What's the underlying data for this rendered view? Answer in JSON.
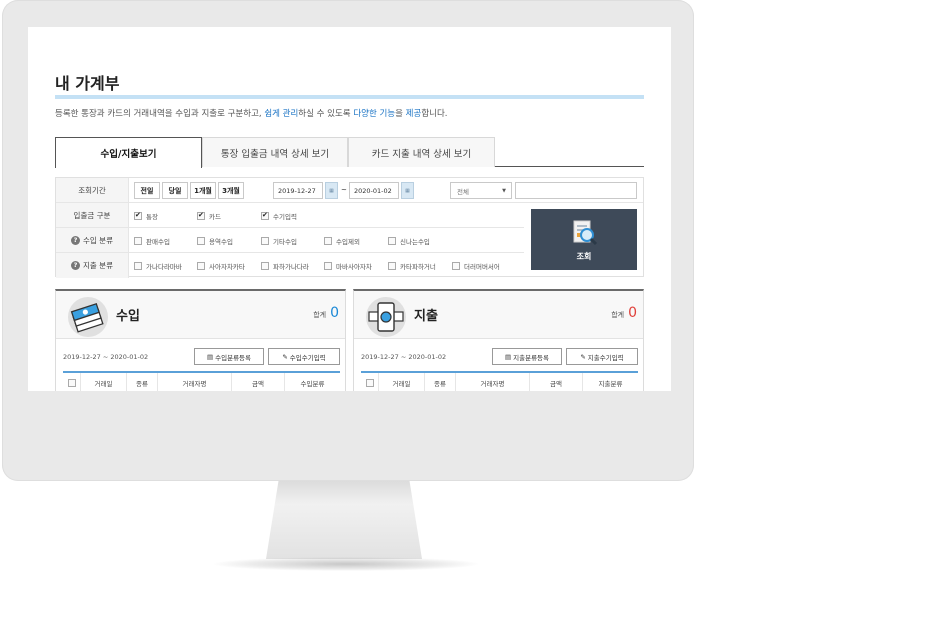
{
  "page": {
    "title": "내 가계부",
    "description": [
      {
        "text": "등록한 통장과 카드의 거래내역을 수입과 지출로 구분하고, ",
        "highlight": false
      },
      {
        "text": "쉽게 관리",
        "highlight": true
      },
      {
        "text": "하실 수 있도록 ",
        "highlight": false
      },
      {
        "text": "다양한 기능",
        "highlight": true
      },
      {
        "text": "을 ",
        "highlight": false
      },
      {
        "text": "제공",
        "highlight": true
      },
      {
        "text": "합니다.",
        "highlight": false
      }
    ]
  },
  "tabs": [
    {
      "label": "수입/지출보기",
      "active": true
    },
    {
      "label": "통장 입출금 내역 상세 보기",
      "active": false
    },
    {
      "label": "카드 지출 내역 상세 보기",
      "active": false
    }
  ],
  "filter": {
    "period_label": "조회기간",
    "period_buttons": [
      "전일",
      "당일",
      "1개월",
      "3개월"
    ],
    "date_from": "2019-12-27",
    "date_sep": "~",
    "date_to": "2020-01-02",
    "select_value": "전체",
    "type_label": "입출금 구분",
    "type_options": [
      {
        "label": "통장",
        "checked": true
      },
      {
        "label": "카드",
        "checked": true
      },
      {
        "label": "수기입력",
        "checked": true
      }
    ],
    "income_cat_label": "수입 분류",
    "income_cats": [
      "판매수입",
      "용역수입",
      "기타수입",
      "수입제외",
      "신나는수입"
    ],
    "expense_cat_label": "지출 분류",
    "expense_cats": [
      "가나다라마바",
      "사아자차카타",
      "파하가나다라",
      "마바사아자차",
      "카타파하거너",
      "더러머버서어"
    ],
    "search_label": "조회"
  },
  "income": {
    "title": "수입",
    "total_label": "합계",
    "total_value": "0",
    "total_color": "#1a88d6",
    "range": "2019-12-27 ~ 2020-01-02",
    "btn1": "수입분류등록",
    "btn2": "수입수기입력",
    "columns": [
      "거래일",
      "종류",
      "거래자명",
      "금액",
      "수입분류"
    ]
  },
  "expense": {
    "title": "지출",
    "total_label": "합계",
    "total_value": "0",
    "total_color": "#e0403a",
    "range": "2019-12-27 ~ 2020-01-02",
    "btn1": "지출분류등록",
    "btn2": "지출수기입력",
    "columns": [
      "거래일",
      "종류",
      "거래자명",
      "금액",
      "지출분류"
    ]
  },
  "colors": {
    "accent_blue": "#1a73c4",
    "title_bar": "#c4e1f5",
    "search_button": "#3e4a59",
    "table_header_line": "#5aa0d8"
  }
}
